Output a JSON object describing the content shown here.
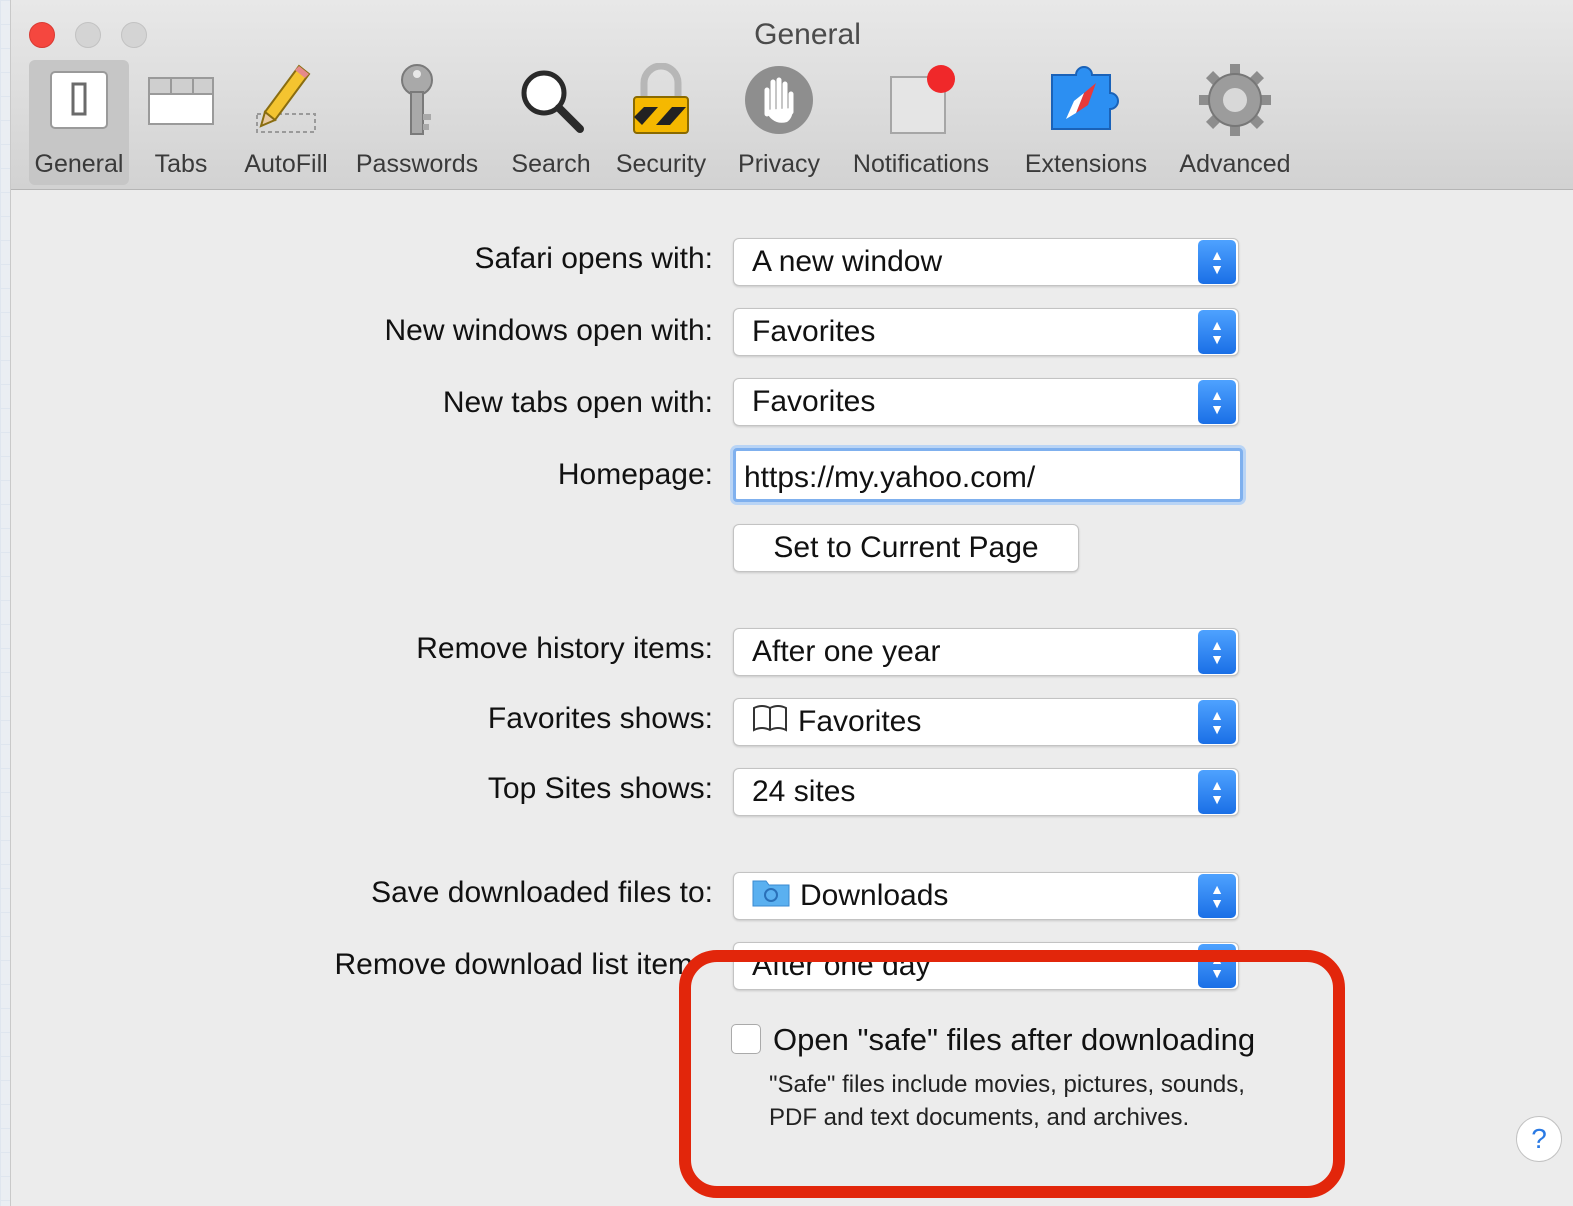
{
  "window": {
    "title": "General"
  },
  "toolbar": {
    "items": [
      {
        "label": "General",
        "icon": "general-icon",
        "selected": true
      },
      {
        "label": "Tabs",
        "icon": "tabs-icon"
      },
      {
        "label": "AutoFill",
        "icon": "pencil-icon"
      },
      {
        "label": "Passwords",
        "icon": "key-icon"
      },
      {
        "label": "Search",
        "icon": "magnifier-icon"
      },
      {
        "label": "Security",
        "icon": "padlock-icon"
      },
      {
        "label": "Privacy",
        "icon": "hand-icon"
      },
      {
        "label": "Notifications",
        "icon": "notification-icon"
      },
      {
        "label": "Extensions",
        "icon": "puzzle-compass-icon"
      },
      {
        "label": "Advanced",
        "icon": "gear-icon"
      }
    ]
  },
  "settings": {
    "safari_opens_label": "Safari opens with:",
    "safari_opens_value": "A new window",
    "new_windows_label": "New windows open with:",
    "new_windows_value": "Favorites",
    "new_tabs_label": "New tabs open with:",
    "new_tabs_value": "Favorites",
    "homepage_label": "Homepage:",
    "homepage_value": "https://my.yahoo.com/",
    "set_current_page": "Set to Current Page",
    "remove_history_label": "Remove history items:",
    "remove_history_value": "After one year",
    "favorites_shows_label": "Favorites shows:",
    "favorites_shows_value": "Favorites",
    "top_sites_label": "Top Sites shows:",
    "top_sites_value": "24 sites",
    "save_downloads_label": "Save downloaded files to:",
    "save_downloads_value": "Downloads",
    "remove_download_label": "Remove download list item",
    "remove_download_value": "After one day",
    "open_safe_label": "Open \"safe\" files after downloading",
    "open_safe_checked": false,
    "open_safe_note": "\"Safe\" files include movies, pictures, sounds, PDF and text documents, and archives."
  },
  "help": {
    "label": "?"
  },
  "colors": {
    "accent": "#1a6fe6",
    "annotation": "#e2260b",
    "close": "#f5473f"
  }
}
